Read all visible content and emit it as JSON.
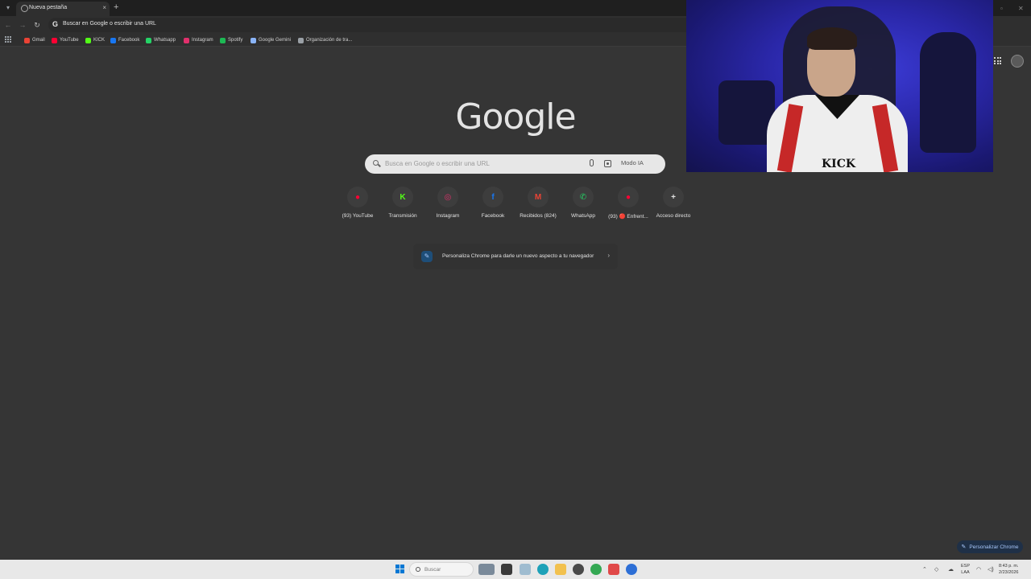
{
  "browser": {
    "tab": {
      "title": "Nueva pestaña",
      "close": "×"
    },
    "new_tab": "+",
    "omnibox": {
      "text": "Buscar en Google o escribir una URL",
      "g": "G"
    },
    "nav": {
      "back": "←",
      "forward": "→",
      "reload": "↻"
    }
  },
  "bookmarks": [
    {
      "label": "Gmail",
      "color": "#ea4335"
    },
    {
      "label": "YouTube",
      "color": "#ff0033"
    },
    {
      "label": "KICK",
      "color": "#53fc18"
    },
    {
      "label": "Facebook",
      "color": "#1877f2"
    },
    {
      "label": "Whatsapp",
      "color": "#25d366"
    },
    {
      "label": "Instagram",
      "color": "#e1306c"
    },
    {
      "label": "Spotify",
      "color": "#1db954"
    },
    {
      "label": "Google Gemini",
      "color": "#8ab4f8"
    },
    {
      "label": "Organización de tra...",
      "color": "#9aa0a6"
    }
  ],
  "google": {
    "logo": "Google",
    "search_placeholder": "Busca en Google o escribir una URL",
    "ai_mode": "Modo IA"
  },
  "shortcuts": [
    {
      "label": "(93) YouTube",
      "glyph": "●",
      "color": "#ff0033"
    },
    {
      "label": "Transmisión",
      "glyph": "K",
      "color": "#53fc18"
    },
    {
      "label": "Instagram",
      "glyph": "◎",
      "color": "#e1306c"
    },
    {
      "label": "Facebook",
      "glyph": "f",
      "color": "#1877f2"
    },
    {
      "label": "Recibidos (824)",
      "glyph": "M",
      "color": "#ea4335"
    },
    {
      "label": "WhatsApp",
      "glyph": "✆",
      "color": "#25d366"
    },
    {
      "label": "(93) 🔴 Enfrent...",
      "glyph": "●",
      "color": "#ff0033"
    },
    {
      "label": "Acceso directo",
      "glyph": "+",
      "color": "#e3e3e3"
    }
  ],
  "customize_banner": {
    "text": "Personaliza Chrome para darle un nuevo aspecto a tu navegador",
    "chevron": "›"
  },
  "personalize_button": "Personalizar Chrome",
  "webcam": {
    "shirt_text": "KICK"
  },
  "taskbar": {
    "search_placeholder": "Buscar",
    "language": [
      "ESP",
      "LAA"
    ],
    "clock": [
      "8:43 p. m.",
      "2/23/2026"
    ]
  },
  "colors": {
    "page_bg": "#353535",
    "accent_blue": "#a8c7fa",
    "windows_blue": "#0078d4"
  }
}
